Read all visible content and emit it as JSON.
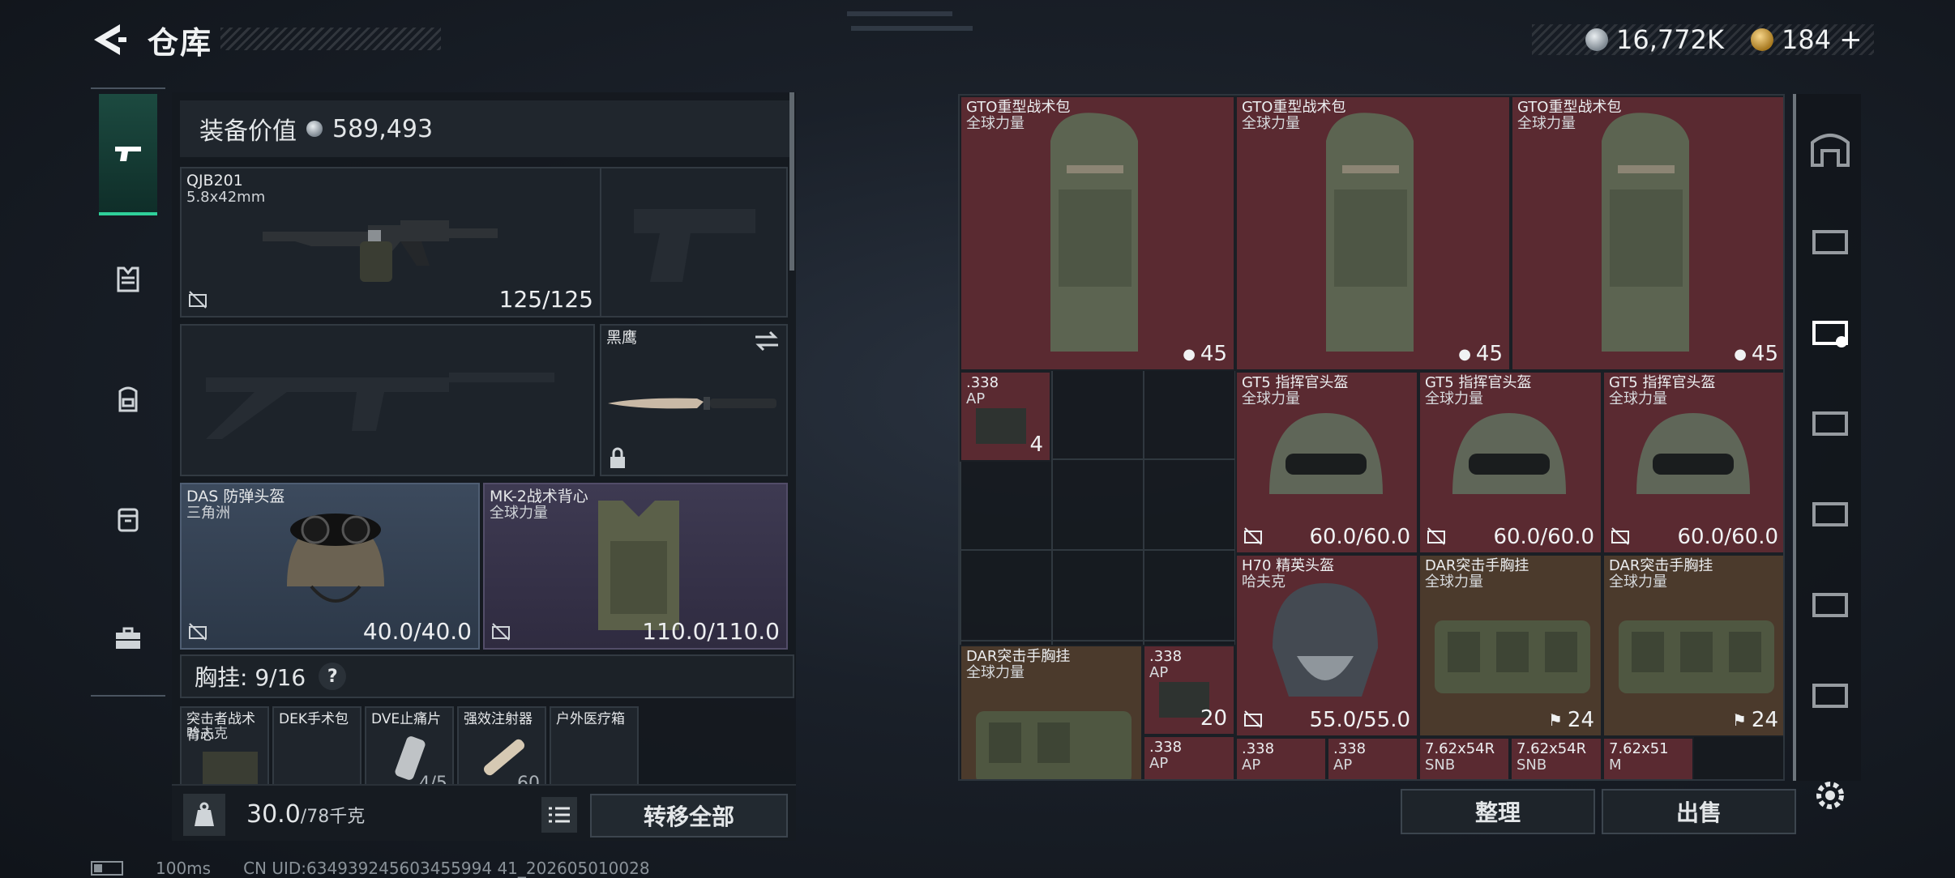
{
  "header": {
    "title": "仓库"
  },
  "currency": {
    "silver": "16,772K",
    "gold": "184"
  },
  "equipment": {
    "value_label": "装备价值",
    "value": "589,493",
    "primary": {
      "name": "QJB201",
      "sub": "5.8x42mm",
      "value": "125/125"
    },
    "melee": {
      "name": "黑鹰"
    },
    "helmet": {
      "name": "DAS 防弹头盔",
      "sub": "三角洲",
      "value": "40.0/40.0"
    },
    "armor": {
      "name": "MK-2战术背心",
      "sub": "全球力量",
      "value": "110.0/110.0"
    },
    "chest": {
      "label": "胸挂:",
      "count": "9/16",
      "help": "?"
    },
    "chest_items": [
      {
        "name": "突击者战术背心",
        "sub": "哈夫克",
        "value": ""
      },
      {
        "name": "DEK手术包",
        "sub": "",
        "value": ""
      },
      {
        "name": "DVE止痛片",
        "sub": "",
        "value": "4/5"
      },
      {
        "name": "强效注射器",
        "sub": "",
        "value": "60"
      },
      {
        "name": "户外医疗箱",
        "sub": "",
        "value": ""
      }
    ],
    "weight": {
      "current": "30.0",
      "max": "/78千克"
    },
    "transfer_all": "转移全部"
  },
  "storage": {
    "items": [
      {
        "name": "GTO重型战术包",
        "sub": "全球力量",
        "value": "45"
      },
      {
        "name": "GTO重型战术包",
        "sub": "全球力量",
        "value": "45"
      },
      {
        "name": "GTO重型战术包",
        "sub": "全球力量",
        "value": "45"
      },
      {
        "name": ".338",
        "sub": "AP",
        "value": "4"
      },
      {
        "name": "GT5 指挥官头盔",
        "sub": "全球力量",
        "value": "60.0/60.0"
      },
      {
        "name": "GT5 指挥官头盔",
        "sub": "全球力量",
        "value": "60.0/60.0"
      },
      {
        "name": "GT5 指挥官头盔",
        "sub": "全球力量",
        "value": "60.0/60.0"
      },
      {
        "name": "H70 精英头盔",
        "sub": "哈夫克",
        "value": "55.0/55.0"
      },
      {
        "name": "DAR突击手胸挂",
        "sub": "全球力量",
        "value": "24"
      },
      {
        "name": "DAR突击手胸挂",
        "sub": "全球力量",
        "value": "24"
      },
      {
        "name": "DAR突击手胸挂",
        "sub": "全球力量",
        "value": ""
      },
      {
        "name": ".338",
        "sub": "AP",
        "value": "20"
      },
      {
        "name": ".338",
        "sub": "AP",
        "value": ""
      },
      {
        "name": ".338",
        "sub": "AP",
        "value": ""
      },
      {
        "name": ".338",
        "sub": "AP",
        "value": ""
      },
      {
        "name": "7.62x54R",
        "sub": "SNB",
        "value": ""
      },
      {
        "name": "7.62x54R",
        "sub": "SNB",
        "value": ""
      },
      {
        "name": "7.62x51",
        "sub": "M",
        "value": ""
      }
    ],
    "sort_label": "整理",
    "sell_label": "出售"
  },
  "status": {
    "ping": "100ms",
    "uid": "CN UID:634939245603455994 41_202605010028"
  },
  "colors": {
    "accent": "#2fd09a",
    "red_item": "#5a2a31",
    "gold_item": "#4b3a2c",
    "blue_item": "#3c4a5d"
  }
}
